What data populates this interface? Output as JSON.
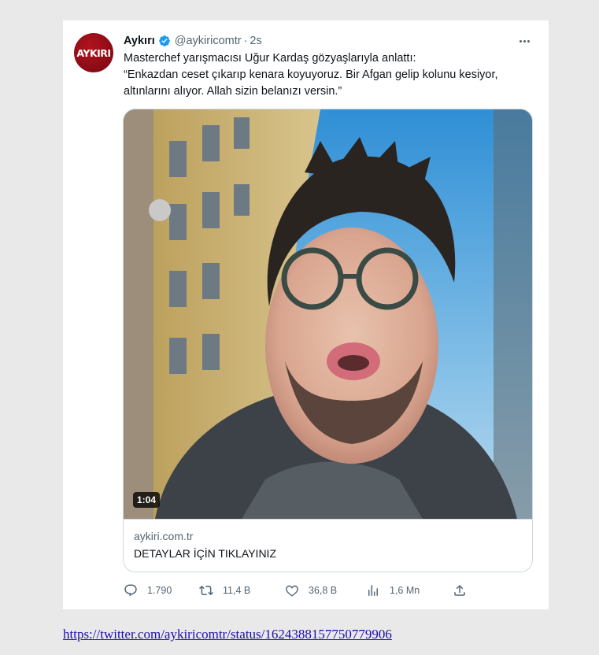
{
  "tweet": {
    "avatar_text": "AYKIRI",
    "author_name": "Aykırı",
    "handle": "@aykiricomtr",
    "separator": "·",
    "time": "2s",
    "text_lines": [
      "Masterchef yarışmacısı Uğur Kardaş gözyaşlarıyla anlattı:",
      "“Enkazdan ceset çıkarıp kenara koyuyoruz. Bir Afgan gelip kolunu kesiyor,",
      "altınlarını alıyor. Allah sizin belanızı versin.”"
    ],
    "video": {
      "duration": "1:04"
    },
    "link_card": {
      "domain": "aykiri.com.tr",
      "title": "DETAYLAR İÇİN TIKLAYINIZ"
    },
    "actions": {
      "replies": "1.790",
      "retweets": "11,4 B",
      "likes": "36,8 B",
      "views": "1,6 Mn"
    }
  },
  "source_link": "https://twitter.com/aykiricomtr/status/1624388157750779906",
  "colors": {
    "verified": "#1d9bf0",
    "secondary_text": "#536471",
    "link": "#1a0dab",
    "avatar_bg": "#a0101a"
  }
}
